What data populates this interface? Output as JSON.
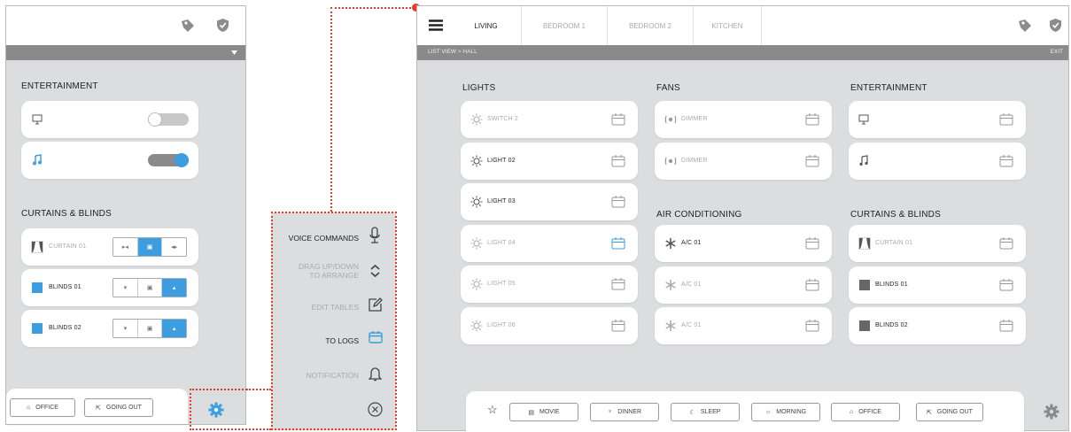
{
  "colors": {
    "accent": "#3d9de1",
    "panel": "#dcdddf",
    "highlight": "#e53b2c",
    "header_bar": "#8a8a8a"
  },
  "left_panel": {
    "entertainment_title": "ENTERTAINMENT",
    "entertainment": [
      {
        "icon": "monitor-icon",
        "on": false
      },
      {
        "icon": "music-icon",
        "on": true
      }
    ],
    "curtains_title": "CURTAINS & BLINDS",
    "curtains": [
      {
        "label": "CURTAIN 01",
        "active": 1
      },
      {
        "label": "BLINDS 01",
        "active": 2
      },
      {
        "label": "BLINDS 02",
        "active": 2
      }
    ],
    "scenes": [
      {
        "label": "OFFICE"
      },
      {
        "label": "GOING OUT"
      }
    ]
  },
  "menu": {
    "items": [
      {
        "label": "VOICE COMMANDS",
        "icon": "microphone-icon"
      },
      {
        "label": "DRAG UP/DOWN\nTO ARRANGE",
        "icon": "reorder-icon"
      },
      {
        "label": "EDIT TABLES",
        "icon": "edit-icon"
      },
      {
        "label": "TO LOGS",
        "icon": "calendar-icon"
      },
      {
        "label": "NOTIFICATION",
        "icon": "bell-icon"
      }
    ]
  },
  "main": {
    "tabs": [
      {
        "label": "LIVING",
        "active": true
      },
      {
        "label": "BEDROOM 1"
      },
      {
        "label": "BEDROOM 2"
      },
      {
        "label": "KITCHEN"
      }
    ],
    "breadcrumb": "LIST VIEW > HALL",
    "exit": "EXIT",
    "lights_title": "LIGHTS",
    "lights": [
      {
        "label": "SWITCH 2",
        "on": false
      },
      {
        "label": "LIGHT 02",
        "on": true
      },
      {
        "label": "LIGHT 03",
        "on": true
      },
      {
        "label": "LIGHT 04",
        "on": false
      },
      {
        "label": "LIGHT 05",
        "on": false
      },
      {
        "label": "LIGHT 06",
        "on": false
      }
    ],
    "fans_title": "FANS",
    "fans": [
      {
        "label": "DIMMER"
      },
      {
        "label": "DIMMER"
      }
    ],
    "ac_title": "AIR CONDITIONING",
    "ac": [
      {
        "label": "A/C 01",
        "on": true
      },
      {
        "label": "A/C 01",
        "on": false
      },
      {
        "label": "A/C 01",
        "on": false
      }
    ],
    "ent_title": "ENTERTAINMENT",
    "curtains_title": "CURTAINS & BLINDS",
    "curtains": [
      {
        "label": "CURTAIN 01",
        "on": false
      },
      {
        "label": "BLINDS 01",
        "on": true
      },
      {
        "label": "BLINDS 02",
        "on": true
      }
    ],
    "scenes": [
      {
        "label": "MOVIE"
      },
      {
        "label": "DINNER"
      },
      {
        "label": "SLEEP"
      },
      {
        "label": "MORNING"
      },
      {
        "label": "OFFICE"
      },
      {
        "label": "GOING OUT"
      }
    ]
  }
}
